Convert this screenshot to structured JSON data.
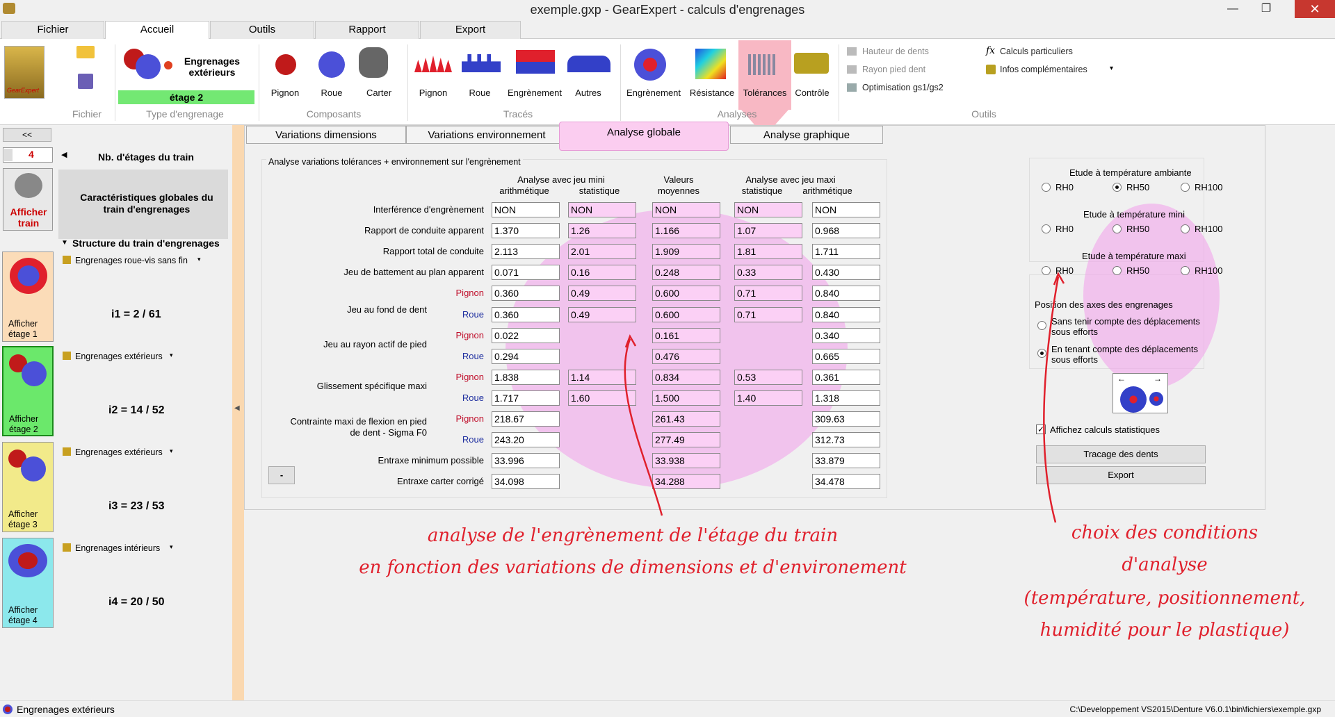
{
  "window": {
    "title": "exemple.gxp - GearExpert - calculs d'engrenages"
  },
  "menu_tabs": [
    {
      "label": "Fichier"
    },
    {
      "label": "Accueil"
    },
    {
      "label": "Outils"
    },
    {
      "label": "Rapport"
    },
    {
      "label": "Export"
    }
  ],
  "ribbon": {
    "fichier_group": "Fichier",
    "gearexpert_logo": "GearExpert",
    "type_group": "Type d'engrenage",
    "type_label": "Engrenages extérieurs",
    "stage_label": "étage 2",
    "composants_group": "Composants",
    "comp_pignon": "Pignon",
    "comp_roue": "Roue",
    "comp_carter": "Carter",
    "traces_group": "Tracés",
    "tr_pignon": "Pignon",
    "tr_roue": "Roue",
    "tr_engrenement": "Engrènement",
    "tr_autres": "Autres",
    "analyses_group": "Analyses",
    "an_engrenement": "Engrènement",
    "an_resistance": "Résistance",
    "an_tolerances": "Tolérances",
    "an_controle": "Contrôle",
    "outils_group": "Outils",
    "hauteur": "Hauteur de dents",
    "rayon": "Rayon pied dent",
    "optimisation": "Optimisation gs1/gs2",
    "calculs": "Calculs particuliers",
    "infos": "Infos complémentaires"
  },
  "left": {
    "collapse": "<<",
    "nb_stages": "4",
    "nb_stages_label": "Nb. d'étages du train",
    "afficher_train": "Afficher train",
    "caracteristiques": "Caractéristiques globales du train d'engrenages",
    "structure": "Structure du train d'engrenages",
    "stages": [
      {
        "type": "Engrenages roue-vis sans fin",
        "ratio": "i1 = 2 / 61",
        "button": "Afficher étage 1"
      },
      {
        "type": "Engrenages extérieurs",
        "ratio": "i2 = 14 / 52",
        "button": "Afficher étage 2"
      },
      {
        "type": "Engrenages extérieurs",
        "ratio": "i3 = 23 / 53",
        "button": "Afficher étage 3"
      },
      {
        "type": "Engrenages intérieurs",
        "ratio": "i4 = 20 / 50",
        "button": "Afficher étage 4"
      }
    ]
  },
  "main": {
    "tabs": [
      {
        "label": "Variations dimensions"
      },
      {
        "label": "Variations environnement"
      },
      {
        "label": "Analyse globale"
      },
      {
        "label": "Analyse graphique"
      }
    ],
    "panel_title": "Analyse variations tolérances + environnement sur l'engrènement",
    "hdr_min": "Analyse avec jeu mini",
    "hdr_arith": "arithmétique",
    "hdr_stat": "statistique",
    "hdr_moy1": "Valeurs",
    "hdr_moy2": "moyennes",
    "hdr_max": "Analyse avec jeu maxi",
    "hdr_stat2": "statistique",
    "hdr_arith2": "arithmétique",
    "pignon": "Pignon",
    "roue": "Roue",
    "rows": [
      {
        "label": "Interférence d'engrènement",
        "sub": "",
        "c": [
          "NON",
          "NON",
          "NON",
          "NON",
          "NON"
        ]
      },
      {
        "label": "Rapport de conduite apparent",
        "sub": "",
        "c": [
          "1.370",
          "1.26",
          "1.166",
          "1.07",
          "0.968"
        ]
      },
      {
        "label": "Rapport total de conduite",
        "sub": "",
        "c": [
          "2.113",
          "2.01",
          "1.909",
          "1.81",
          "1.711"
        ]
      },
      {
        "label": "Jeu de battement au plan apparent",
        "sub": "",
        "c": [
          "0.071",
          "0.16",
          "0.248",
          "0.33",
          "0.430"
        ]
      },
      {
        "label": "",
        "sub": "Pignon",
        "c": [
          "0.360",
          "0.49",
          "0.600",
          "0.71",
          "0.840"
        ]
      },
      {
        "label": "",
        "sub": "Roue",
        "c": [
          "0.360",
          "0.49",
          "0.600",
          "0.71",
          "0.840"
        ]
      },
      {
        "label": "",
        "sub": "Pignon",
        "c": [
          "0.022",
          "",
          "0.161",
          "",
          "0.340"
        ]
      },
      {
        "label": "",
        "sub": "Roue",
        "c": [
          "0.294",
          "",
          "0.476",
          "",
          "0.665"
        ]
      },
      {
        "label": "",
        "sub": "Pignon",
        "c": [
          "1.838",
          "1.14",
          "0.834",
          "0.53",
          "0.361"
        ]
      },
      {
        "label": "",
        "sub": "Roue",
        "c": [
          "1.717",
          "1.60",
          "1.500",
          "1.40",
          "1.318"
        ]
      },
      {
        "label": "",
        "sub": "Pignon",
        "c": [
          "218.67",
          "",
          "261.43",
          "",
          "309.63"
        ]
      },
      {
        "label": "",
        "sub": "Roue",
        "c": [
          "243.20",
          "",
          "277.49",
          "",
          "312.73"
        ]
      },
      {
        "label": "Entraxe minimum possible",
        "sub": "",
        "c": [
          "33.996",
          "",
          "33.938",
          "",
          "33.879"
        ]
      },
      {
        "label": "Entraxe carter corrigé",
        "sub": "",
        "c": [
          "34.098",
          "",
          "34.288",
          "",
          "34.478"
        ]
      }
    ],
    "group_labels": {
      "jeu_fond": "Jeu au fond de dent",
      "jeu_rayon": "Jeu au rayon actif de pied",
      "glissement": "Glissement spécifique maxi",
      "contrainte1": "Contrainte maxi de flexion en pied",
      "contrainte2": "de dent - Sigma F0"
    },
    "minus_button": "-",
    "temp_ambiante": "Etude à température ambiante",
    "temp_mini": "Etude à température mini",
    "temp_maxi": "Etude à température maxi",
    "rh0": "RH0",
    "rh50": "RH50",
    "rh100": "RH100",
    "position_title": "Position des axes des engrenages",
    "sans1": "Sans tenir compte des déplacements",
    "sans2": "sous efforts",
    "avec1": "En tenant compte des déplacements",
    "avec2": "sous efforts",
    "affichez": "Affichez calculs statistiques",
    "tracage": "Tracage des dents",
    "export": "Export"
  },
  "annotations": {
    "left1": "analyse de l'engrènement de l'étage du train",
    "left2": "en fonction des variations de dimensions et d'environement",
    "right1": "choix des conditions",
    "right2": "d'analyse",
    "right3": "(température, positionnement,",
    "right4": "humidité pour le plastique)"
  },
  "status": {
    "left": "Engrenages extérieurs",
    "right": "C:\\Developpement VS2015\\Denture V6.0.1\\bin\\fichiers\\exemple.gxp"
  },
  "colors": {
    "accent_pink": "#fbd0f5",
    "highlight": "#e070d8",
    "annotation_red": "#e0202c",
    "stage_green": "#6be86b"
  }
}
